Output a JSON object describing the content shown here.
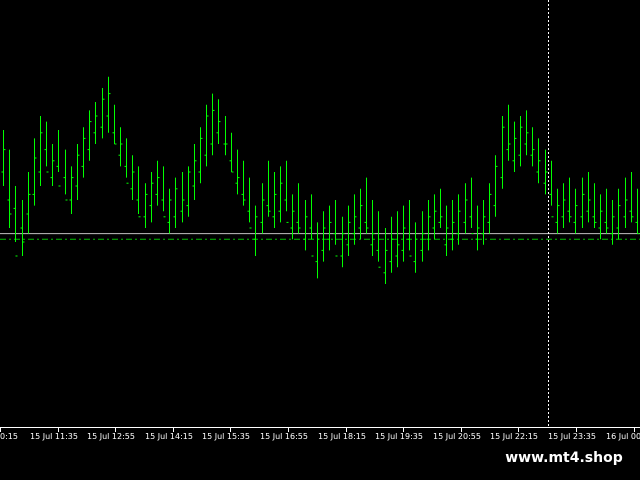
{
  "colors": {
    "background": "#000000",
    "bar": "#00ff00",
    "bid_line": "#c0c0c0",
    "ask_line": "#00c000",
    "crosshair": "#ffffff",
    "axis_text": "#ffffff"
  },
  "chart_data": {
    "type": "bar",
    "x_tick_labels": [
      "0:15",
      "15 Jul 11:35",
      "15 Jul 12:55",
      "15 Jul 14:15",
      "15 Jul 15:35",
      "15 Jul 16:55",
      "15 Jul 18:15",
      "15 Jul 19:35",
      "15 Jul 20:55",
      "15 Jul 22:15",
      "15 Jul 23:35",
      "16 Jul 00:"
    ],
    "ylim": [
      0,
      100
    ],
    "bid_level": 38,
    "ask_level": 36,
    "crosshair_x_index": 10,
    "bars": [
      [
        55,
        75,
        60,
        68
      ],
      [
        40,
        68,
        50,
        45
      ],
      [
        35,
        55,
        47,
        30
      ],
      [
        30,
        50,
        40,
        35
      ],
      [
        38,
        60,
        45,
        52
      ],
      [
        48,
        72,
        52,
        65
      ],
      [
        55,
        80,
        60,
        74
      ],
      [
        62,
        78,
        68,
        60
      ],
      [
        55,
        70,
        58,
        64
      ],
      [
        60,
        75,
        62,
        55
      ],
      [
        52,
        68,
        58,
        50
      ],
      [
        45,
        62,
        50,
        58
      ],
      [
        50,
        70,
        55,
        66
      ],
      [
        58,
        76,
        62,
        72
      ],
      [
        64,
        82,
        68,
        78
      ],
      [
        70,
        85,
        74,
        80
      ],
      [
        72,
        90,
        76,
        86
      ],
      [
        74,
        94,
        80,
        88
      ],
      [
        70,
        84,
        74,
        70
      ],
      [
        62,
        76,
        66,
        70
      ],
      [
        58,
        72,
        62,
        56
      ],
      [
        50,
        66,
        54,
        60
      ],
      [
        45,
        62,
        50,
        44
      ],
      [
        40,
        56,
        44,
        52
      ],
      [
        42,
        60,
        48,
        56
      ],
      [
        48,
        64,
        52,
        58
      ],
      [
        46,
        62,
        50,
        44
      ],
      [
        38,
        54,
        42,
        50
      ],
      [
        40,
        58,
        44,
        54
      ],
      [
        42,
        60,
        46,
        50
      ],
      [
        44,
        62,
        48,
        60
      ],
      [
        50,
        70,
        55,
        64
      ],
      [
        56,
        76,
        60,
        72
      ],
      [
        62,
        84,
        66,
        80
      ],
      [
        66,
        88,
        70,
        82
      ],
      [
        70,
        86,
        74,
        78
      ],
      [
        66,
        80,
        70,
        70
      ],
      [
        60,
        74,
        64,
        60
      ],
      [
        52,
        68,
        56,
        58
      ],
      [
        48,
        64,
        52,
        50
      ],
      [
        42,
        58,
        46,
        40
      ],
      [
        30,
        48,
        36,
        44
      ],
      [
        38,
        56,
        42,
        50
      ],
      [
        44,
        64,
        48,
        46
      ],
      [
        40,
        60,
        44,
        52
      ],
      [
        42,
        62,
        46,
        56
      ],
      [
        46,
        64,
        50,
        42
      ],
      [
        36,
        52,
        40,
        46
      ],
      [
        38,
        56,
        42,
        40
      ],
      [
        32,
        50,
        36,
        44
      ],
      [
        36,
        52,
        40,
        30
      ],
      [
        22,
        42,
        28,
        36
      ],
      [
        28,
        46,
        32,
        40
      ],
      [
        32,
        48,
        36,
        42
      ],
      [
        34,
        50,
        38,
        30
      ],
      [
        26,
        44,
        30,
        38
      ],
      [
        30,
        48,
        34,
        42
      ],
      [
        34,
        52,
        38,
        44
      ],
      [
        36,
        54,
        40,
        48
      ],
      [
        38,
        58,
        42,
        40
      ],
      [
        30,
        50,
        34,
        38
      ],
      [
        28,
        46,
        32,
        26
      ],
      [
        20,
        40,
        24,
        32
      ],
      [
        24,
        44,
        28,
        36
      ],
      [
        26,
        46,
        30,
        34
      ],
      [
        28,
        48,
        32,
        40
      ],
      [
        32,
        50,
        36,
        30
      ],
      [
        24,
        42,
        28,
        36
      ],
      [
        28,
        46,
        32,
        38
      ],
      [
        32,
        50,
        36,
        44
      ],
      [
        36,
        52,
        40,
        46
      ],
      [
        40,
        54,
        42,
        44
      ],
      [
        30,
        48,
        34,
        40
      ],
      [
        32,
        50,
        36,
        42
      ],
      [
        34,
        52,
        38,
        46
      ],
      [
        38,
        56,
        42,
        50
      ],
      [
        40,
        58,
        44,
        38
      ],
      [
        32,
        48,
        36,
        40
      ],
      [
        34,
        50,
        38,
        44
      ],
      [
        38,
        56,
        42,
        52
      ],
      [
        44,
        66,
        48,
        62
      ],
      [
        54,
        80,
        58,
        76
      ],
      [
        64,
        84,
        68,
        70
      ],
      [
        60,
        78,
        64,
        72
      ],
      [
        62,
        80,
        66,
        76
      ],
      [
        66,
        82,
        70,
        74
      ],
      [
        62,
        76,
        66,
        68
      ],
      [
        56,
        72,
        60,
        64
      ],
      [
        52,
        68,
        56,
        60
      ],
      [
        48,
        64,
        52,
        44
      ],
      [
        38,
        54,
        42,
        48
      ],
      [
        40,
        56,
        44,
        50
      ],
      [
        42,
        58,
        46,
        44
      ],
      [
        38,
        54,
        42,
        48
      ],
      [
        40,
        58,
        44,
        52
      ],
      [
        42,
        60,
        46,
        50
      ],
      [
        40,
        56,
        44,
        42
      ],
      [
        36,
        52,
        40,
        46
      ],
      [
        38,
        54,
        42,
        40
      ],
      [
        34,
        50,
        38,
        44
      ],
      [
        36,
        54,
        40,
        48
      ],
      [
        40,
        58,
        44,
        50
      ],
      [
        42,
        60,
        46,
        44
      ],
      [
        38,
        54,
        42,
        38
      ]
    ]
  },
  "watermark": {
    "text": "www.mt4.shop"
  }
}
